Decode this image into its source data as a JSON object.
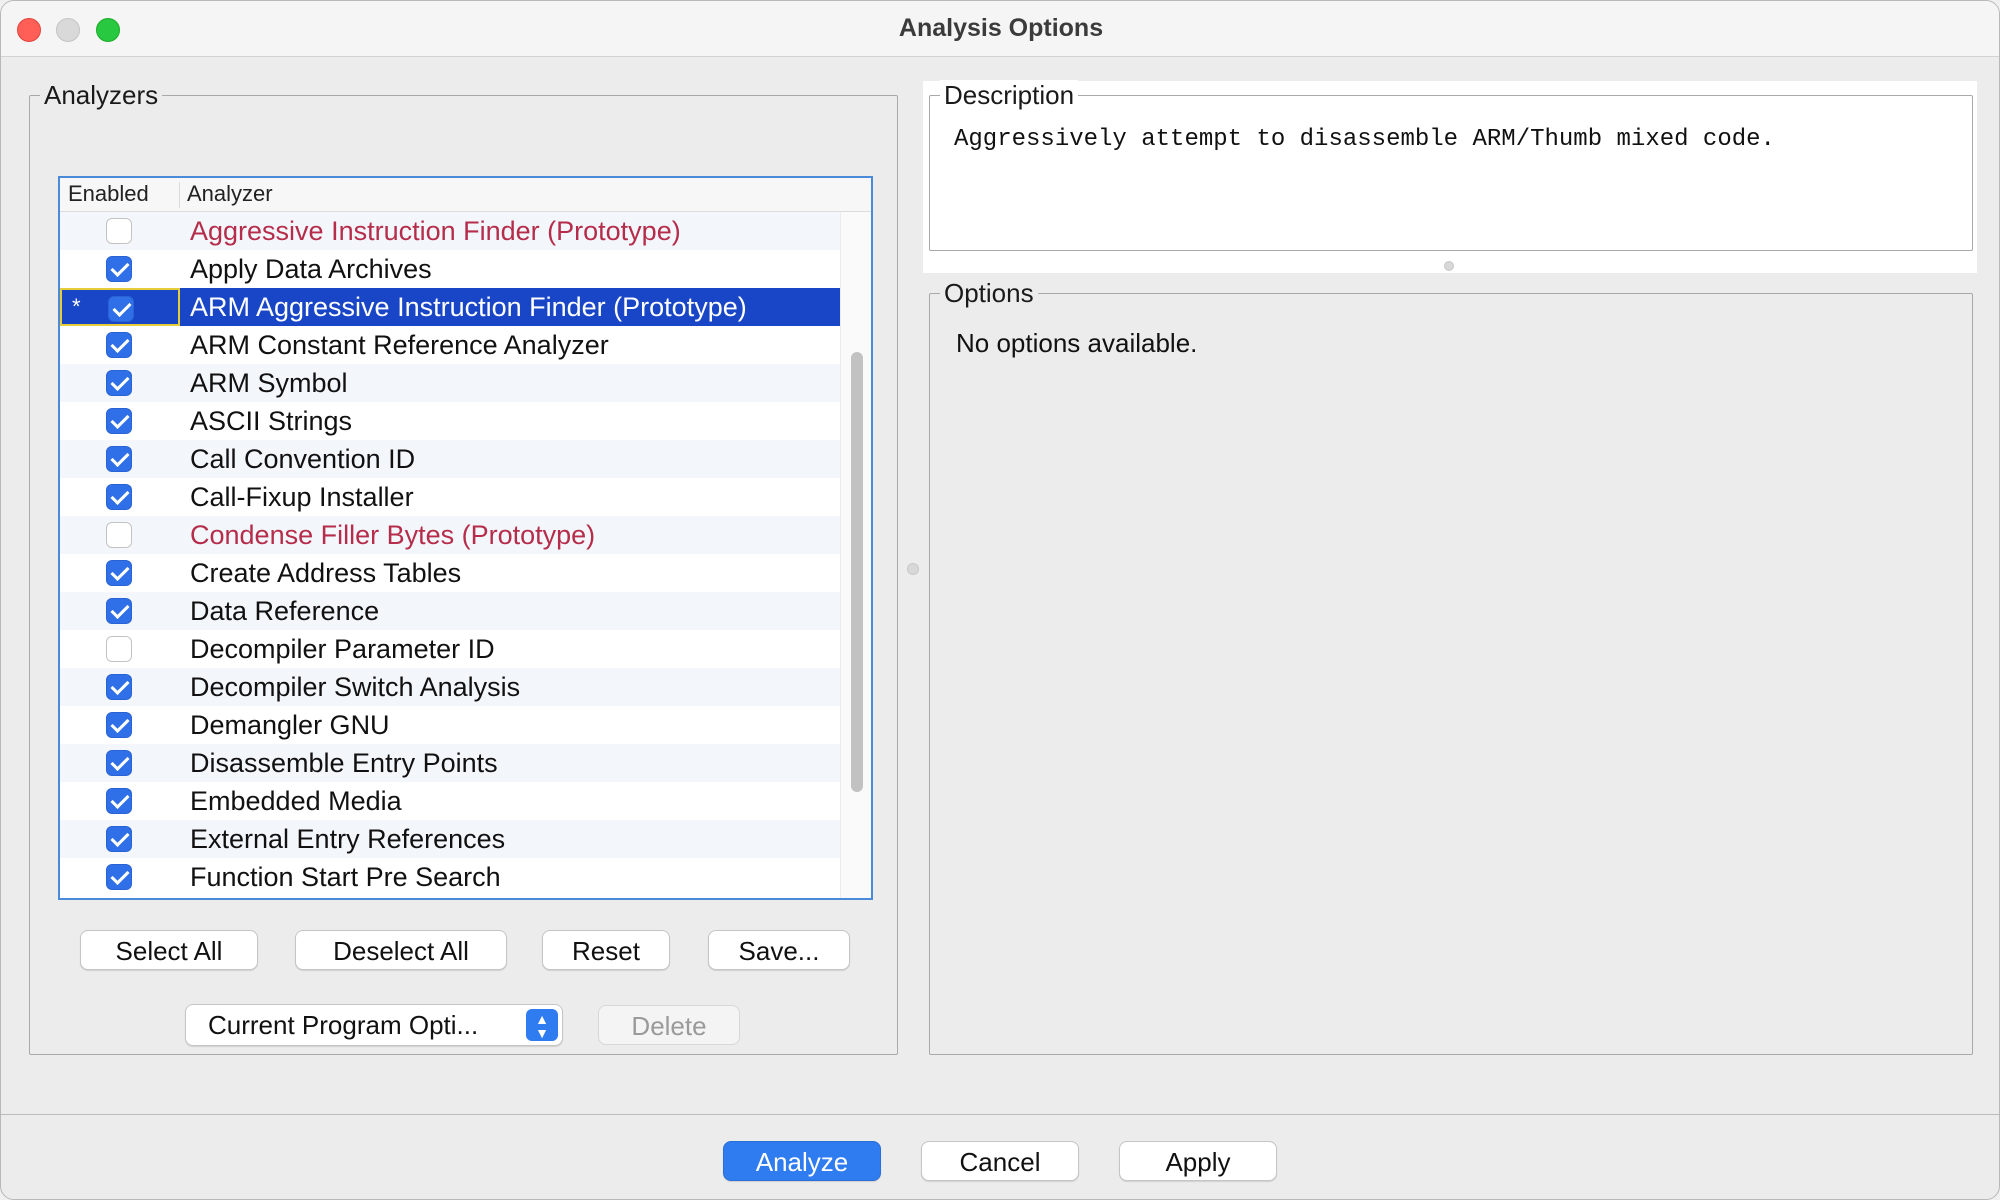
{
  "window": {
    "title": "Analysis Options"
  },
  "analyzers_panel": {
    "legend": "Analyzers",
    "columns": {
      "enabled": "Enabled",
      "analyzer": "Analyzer"
    },
    "rows": [
      {
        "name": "Aggressive Instruction Finder (Prototype)",
        "enabled": false,
        "prototype": true,
        "selected": false,
        "marker": ""
      },
      {
        "name": "Apply Data Archives",
        "enabled": true,
        "prototype": false,
        "selected": false,
        "marker": ""
      },
      {
        "name": "ARM Aggressive Instruction Finder (Prototype)",
        "enabled": true,
        "prototype": true,
        "selected": true,
        "marker": "*"
      },
      {
        "name": "ARM Constant Reference Analyzer",
        "enabled": true,
        "prototype": false,
        "selected": false,
        "marker": ""
      },
      {
        "name": "ARM Symbol",
        "enabled": true,
        "prototype": false,
        "selected": false,
        "marker": ""
      },
      {
        "name": "ASCII Strings",
        "enabled": true,
        "prototype": false,
        "selected": false,
        "marker": ""
      },
      {
        "name": "Call Convention ID",
        "enabled": true,
        "prototype": false,
        "selected": false,
        "marker": ""
      },
      {
        "name": "Call-Fixup Installer",
        "enabled": true,
        "prototype": false,
        "selected": false,
        "marker": ""
      },
      {
        "name": "Condense Filler Bytes (Prototype)",
        "enabled": false,
        "prototype": true,
        "selected": false,
        "marker": ""
      },
      {
        "name": "Create Address Tables",
        "enabled": true,
        "prototype": false,
        "selected": false,
        "marker": ""
      },
      {
        "name": "Data Reference",
        "enabled": true,
        "prototype": false,
        "selected": false,
        "marker": ""
      },
      {
        "name": "Decompiler Parameter ID",
        "enabled": false,
        "prototype": false,
        "selected": false,
        "marker": ""
      },
      {
        "name": "Decompiler Switch Analysis",
        "enabled": true,
        "prototype": false,
        "selected": false,
        "marker": ""
      },
      {
        "name": "Demangler GNU",
        "enabled": true,
        "prototype": false,
        "selected": false,
        "marker": ""
      },
      {
        "name": "Disassemble Entry Points",
        "enabled": true,
        "prototype": false,
        "selected": false,
        "marker": ""
      },
      {
        "name": "Embedded Media",
        "enabled": true,
        "prototype": false,
        "selected": false,
        "marker": ""
      },
      {
        "name": "External Entry References",
        "enabled": true,
        "prototype": false,
        "selected": false,
        "marker": ""
      },
      {
        "name": "Function Start Pre Search",
        "enabled": true,
        "prototype": false,
        "selected": false,
        "marker": ""
      }
    ],
    "buttons": {
      "select_all": "Select All",
      "deselect_all": "Deselect All",
      "reset": "Reset",
      "save": "Save..."
    },
    "options_select": {
      "value": "Current Program Opti..."
    },
    "delete_button": "Delete"
  },
  "description_panel": {
    "legend": "Description",
    "text": "Aggressively attempt to disassemble ARM/Thumb mixed code."
  },
  "options_panel": {
    "legend": "Options",
    "text": "No options available."
  },
  "footer": {
    "analyze": "Analyze",
    "cancel": "Cancel",
    "apply": "Apply"
  },
  "colors": {
    "accent": "#2f7bf0",
    "selection": "#1846c6",
    "prototype_text": "#b52d4a",
    "checkbox_checked": "#2f6fe8"
  },
  "icons": {
    "close": "close-traffic-light-icon",
    "minimize": "minimize-traffic-light-icon",
    "zoom": "zoom-traffic-light-icon",
    "select_arrows": "updown-chevrons-icon"
  }
}
